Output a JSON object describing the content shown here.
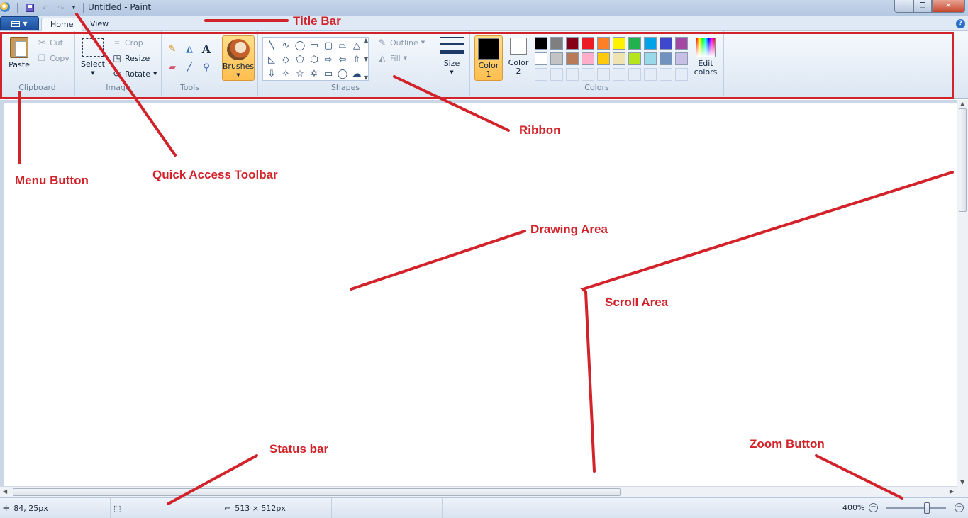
{
  "window": {
    "title": "Untitled - Paint",
    "min_glyph": "–",
    "max_glyph": "❐",
    "close_glyph": "✕"
  },
  "quick_access": {
    "undo_glyph": "↶",
    "redo_glyph": "↷",
    "more_glyph": "▾"
  },
  "tabs": [
    {
      "label": "Home",
      "active": true
    },
    {
      "label": "View",
      "active": false
    }
  ],
  "help_glyph": "?",
  "ribbon": {
    "clipboard": {
      "label": "Clipboard",
      "paste": "Paste",
      "cut": "Cut",
      "copy": "Copy",
      "cut_icon": "✂",
      "copy_icon": "❐"
    },
    "image": {
      "label": "Image",
      "select": "Select",
      "crop": "Crop",
      "resize": "Resize",
      "rotate": "Rotate",
      "crop_icon": "⌗",
      "resize_icon": "◳",
      "rotate_icon": "⟳"
    },
    "tools": {
      "label": "Tools",
      "pencil_icon": "✎",
      "fill_icon": "◭",
      "text_icon": "A",
      "eraser_icon": "▰",
      "picker_icon": "╱",
      "magnifier_icon": "⚲"
    },
    "brushes": {
      "label": "Brushes"
    },
    "shapes": {
      "label": "Shapes",
      "outline": "Outline",
      "fill": "Fill",
      "outline_icon": "✎",
      "fill_icon": "◭",
      "glyphs": [
        "╲",
        "∿",
        "◯",
        "▭",
        "▢",
        "⏢",
        "△",
        "◺",
        "◇",
        "⬠",
        "⬡",
        "⇨",
        "⇦",
        "⇧",
        "⇩",
        "✧",
        "☆",
        "✡",
        "▭",
        "◯",
        "☁"
      ]
    },
    "size": {
      "label": "Size"
    },
    "colors": {
      "label": "Colors",
      "color1_line1": "Color",
      "color1_line2": "1",
      "color2_line1": "Color",
      "color2_line2": "2",
      "edit_line1": "Edit",
      "edit_line2": "colors",
      "color1_value": "#000000",
      "color2_value": "#ffffff",
      "palette": [
        "#000000",
        "#7f7f7f",
        "#880015",
        "#ed1c24",
        "#ff7f27",
        "#fff200",
        "#22b14c",
        "#00a2e8",
        "#3f48cc",
        "#a349a4",
        "#ffffff",
        "#c3c3c3",
        "#b97a57",
        "#ffaec9",
        "#ffc90e",
        "#efe4b0",
        "#b5e61d",
        "#99d9ea",
        "#7092be",
        "#c8bfe7"
      ],
      "empty_slots": 10
    }
  },
  "status": {
    "cursor_pos": "84, 25px",
    "canvas_size": "513 × 512px",
    "zoom": "400%",
    "pos_icon": "✛",
    "sel_icon": "⬚",
    "size_icon": "⌐"
  },
  "annotations": {
    "title_bar": "Title Bar",
    "ribbon": "Ribbon",
    "menu_button": "Menu Button",
    "quick_access": "Quick Access Toolbar",
    "drawing_area": "Drawing Area",
    "scroll_area": "Scroll Area",
    "status_bar": "Status bar",
    "zoom_button": "Zoom Button"
  }
}
